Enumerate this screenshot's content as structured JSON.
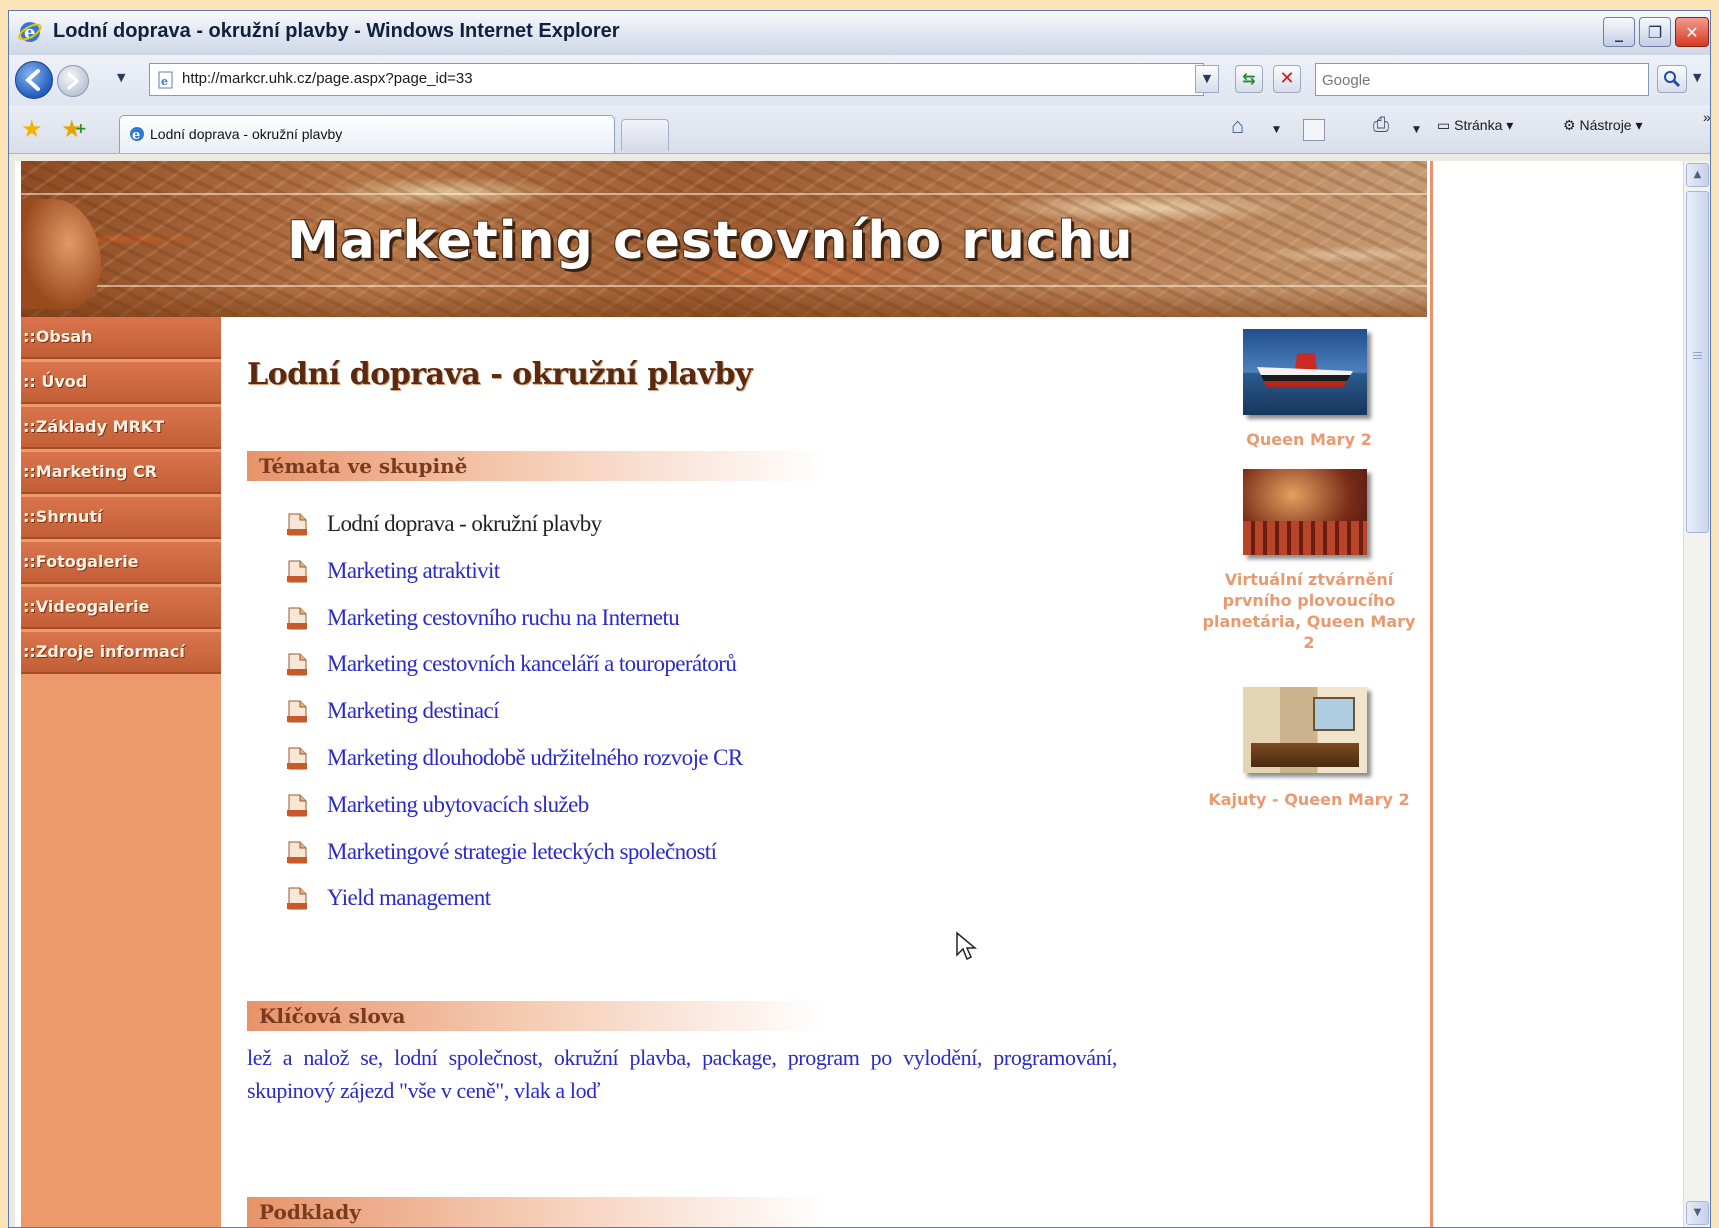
{
  "browser": {
    "window_title": "Lodní doprava - okružní plavby - Windows Internet Explorer",
    "address_url": "http://markcr.uhk.cz/page.aspx?page_id=33",
    "search_placeholder": "Google",
    "tab_label": "Lodní doprava - okružní plavby",
    "commands": {
      "page_label": "Stránka",
      "tools_label": "Nástroje",
      "more_label": "»"
    },
    "window_buttons": {
      "minimize": "_",
      "maximize": "❐",
      "close": "✕"
    }
  },
  "site": {
    "banner_title": "Marketing cestovního ruchu",
    "sidebar": {
      "items": [
        {
          "label": "::Obsah"
        },
        {
          "label": ":: Úvod"
        },
        {
          "label": "::Základy MRKT"
        },
        {
          "label": "::Marketing CR"
        },
        {
          "label": "::Shrnutí"
        },
        {
          "label": "::Fotogalerie"
        },
        {
          "label": "::Videogalerie"
        },
        {
          "label": "::Zdroje informací"
        }
      ]
    },
    "main": {
      "page_title": "Lodní doprava - okružní plavby",
      "topics_heading": "Témata ve skupině",
      "topics": [
        {
          "label": "Lodní doprava - okružní plavby",
          "is_link": false
        },
        {
          "label": "Marketing atraktivit",
          "is_link": true
        },
        {
          "label": "Marketing cestovního ruchu na Internetu",
          "is_link": true
        },
        {
          "label": "Marketing cestovních kanceláří a touroperátorů",
          "is_link": true
        },
        {
          "label": "Marketing destinací",
          "is_link": true
        },
        {
          "label": "Marketing dlouhodobě udržitelného rozvoje CR",
          "is_link": true
        },
        {
          "label": "Marketing ubytovacích služeb",
          "is_link": true
        },
        {
          "label": "Marketingové strategie leteckých společností",
          "is_link": true
        },
        {
          "label": "Yield management",
          "is_link": true
        }
      ],
      "keywords_heading": "Klíčová slova",
      "keywords_text": "lež a nalož se, lodní společnost, okružní plavba, package, program po vylodění, programování, skupinový zájezd \"vše v ceně\", vlak a loď",
      "next_heading": "Podklady"
    },
    "gallery": [
      {
        "caption": "Queen Mary 2",
        "image": "ship-photo"
      },
      {
        "caption": "Virtuální ztvárnění prvního plovoucího planetária, Queen Mary 2",
        "image": "planetarium-photo"
      },
      {
        "caption": "Kajuty - Queen Mary 2",
        "image": "cabin-photo"
      }
    ]
  },
  "colors": {
    "sidebar_bg": "#ec9a6c",
    "menu_item": "#c35f37",
    "link": "#2a2ac8",
    "caption": "#e89a70",
    "frame_border": "#e8916a"
  }
}
